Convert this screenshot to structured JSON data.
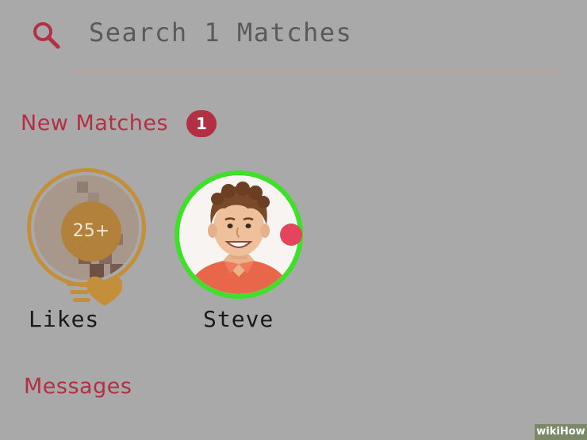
{
  "search": {
    "text": "Search 1 Matches",
    "icon": "search-icon"
  },
  "new_matches": {
    "heading": "New Matches",
    "count": "1"
  },
  "likes": {
    "count": "25+",
    "label": "Likes",
    "icon": "heart-icon"
  },
  "match": {
    "name": "Steve",
    "ring_color": "#3ee02a",
    "dot_color": "#e4455d"
  },
  "messages": {
    "heading": "Messages"
  },
  "colors": {
    "accent": "#b32f44",
    "likes_gold": "#c48f3a"
  },
  "watermark": {
    "text": "wikiHow"
  }
}
